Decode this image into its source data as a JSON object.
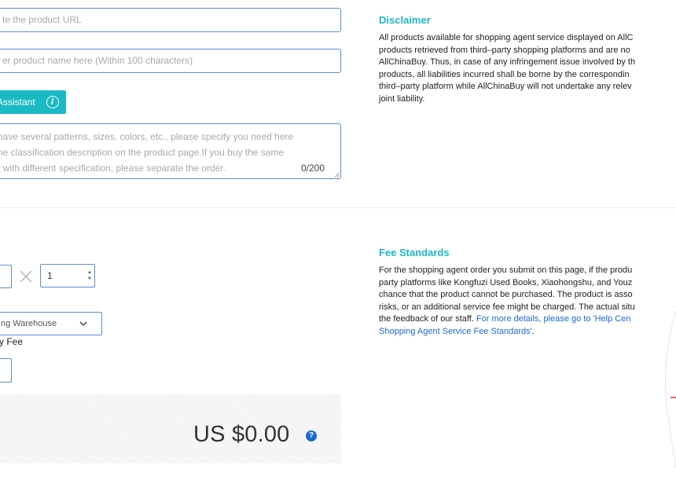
{
  "form": {
    "url_placeholder": "te the product URL",
    "name_placeholder": "er product name here (Within 100 characters)",
    "assistant_label": "Assistant",
    "spec_placeholder_lines": [
      "have several patterns, sizes, colors, etc., please specify you need here",
      "he classification description on the product page.If you buy the same",
      "t with different specification, please separate the order."
    ],
    "spec_count": "0/200",
    "quantity_value": "1",
    "multiply_symbol": "×",
    "warehouse_select": "ng Warehouse",
    "delivery_fee_label": "y Fee",
    "total": "US $0.00",
    "help_symbol": "?"
  },
  "disclaimer": {
    "title": "Disclaimer",
    "lines": [
      "All products available for shopping agent service displayed on AllC",
      "products retrieved from third–party shopping platforms and are no",
      "AllChinaBuy. Thus, in case of any infringement issue involved by th",
      "products, all liabilities incurred shall be borne by the correspondin",
      "third–party platform while AllChinaBuy will not undertake any relev",
      "joint liability."
    ]
  },
  "fee_standards": {
    "title": "Fee Standards",
    "lines": [
      "For the shopping agent order you submit on this page, if the produ",
      "party platforms like Kongfuzi Used Books, Xiaohongshu, and Youz",
      "chance that the product cannot be purchased. The product is asso",
      "risks, or an additional service fee might be charged. The actual situ"
    ],
    "line5_text": "the feedback of our staff. ",
    "line5_link": "For more details, please go to 'Help Cen",
    "line6_link": "Shopping Agent Service Fee Standards'",
    "line6_end": "."
  },
  "colors": {
    "accent": "#1bb9c4",
    "border": "#5b8fd6",
    "link": "#1a6ad6",
    "panel": "#f3f3f3"
  }
}
